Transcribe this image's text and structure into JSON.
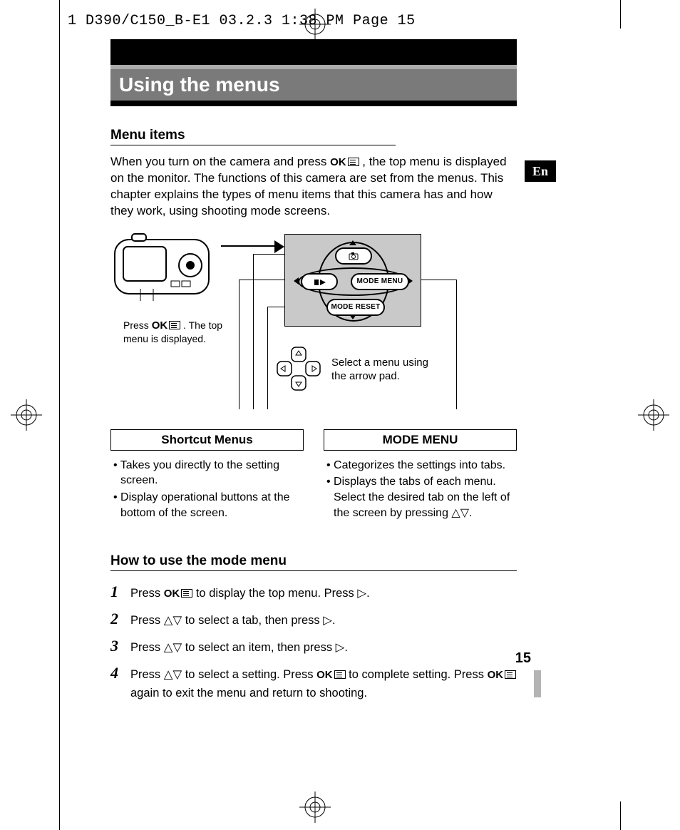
{
  "print_meta": "1 D390/C150_B-E1  03.2.3 1:38 PM  Page 15",
  "title": "Using the menus",
  "lang_tab": "En",
  "section_menu_items": "Menu items",
  "intro_pre": "When you turn on the camera and press ",
  "intro_post": ", the top menu is displayed on the monitor. The functions of this camera are set from the menus. This chapter explains the types of menu items that this camera has and how they work, using shooting mode screens.",
  "ok_label": "OK",
  "camera_caption_pre": "Press ",
  "camera_caption_post": " . The top menu is displayed.",
  "lcd": {
    "mode_menu": "MODE MENU",
    "mode_reset": "MODE RESET"
  },
  "dpad_caption": "Select a menu using the arrow pad.",
  "col_left_head": "Shortcut Menus",
  "col_left_b1": "• Takes you directly to the setting screen.",
  "col_left_b2": "• Display operational buttons at the bottom of the screen.",
  "col_right_head": "MODE MENU",
  "col_right_b1": "• Categorizes the settings into tabs.",
  "col_right_b2": "• Displays the tabs of each menu. Select the desired tab on the left of the screen by pressing △▽.",
  "section_howto": "How to use the mode menu",
  "steps": {
    "n1": "1",
    "s1a": "Press ",
    "s1b": " to display the top menu. Press ▷.",
    "n2": "2",
    "s2": "Press △▽ to select a tab, then press ▷.",
    "n3": "3",
    "s3": "Press △▽ to select an item, then press ▷.",
    "n4": "4",
    "s4a": "Press  △▽ to select a setting. Press ",
    "s4b": " to complete setting. Press ",
    "s4c": " again to exit the menu and return to shooting."
  },
  "page_number": "15"
}
